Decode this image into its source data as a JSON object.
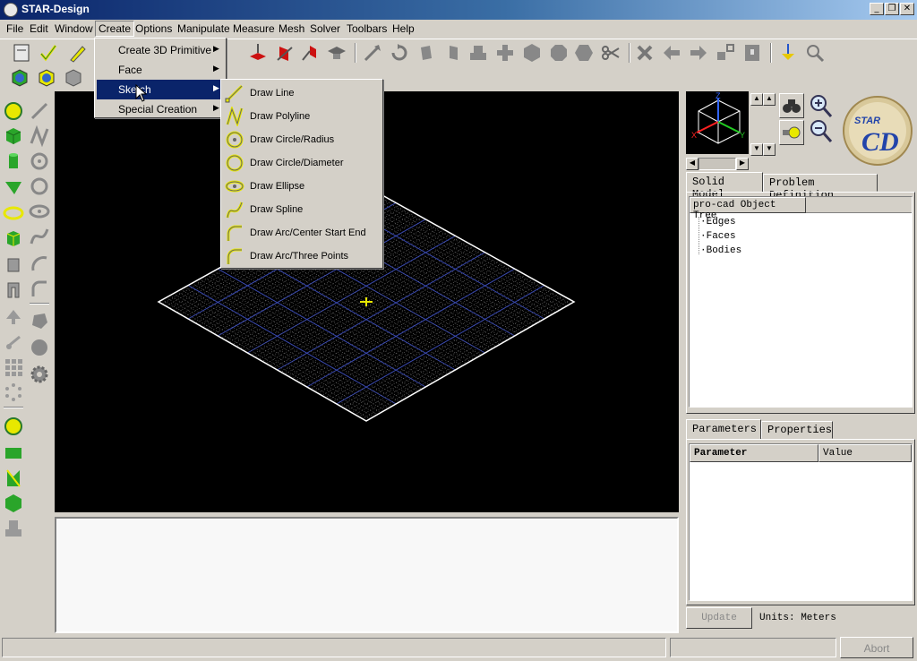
{
  "window": {
    "title": "STAR-Design",
    "controls": [
      "_",
      "❐",
      "✕"
    ]
  },
  "menubar": [
    "File",
    "Edit",
    "Window",
    "Create",
    "Options",
    "Manipulate",
    "Measure",
    "Mesh",
    "Solver",
    "Toolbars",
    "Help"
  ],
  "create_menu": {
    "items": [
      "Create 3D Primitive",
      "Face",
      "Sketch",
      "Special Creation"
    ],
    "highlighted": "Sketch"
  },
  "sketch_menu": {
    "items": [
      "Draw Line",
      "Draw Polyline",
      "Draw Circle/Radius",
      "Draw Circle/Diameter",
      "Draw Ellipse",
      "Draw Spline",
      "Draw Arc/Center Start End",
      "Draw Arc/Three Points"
    ]
  },
  "right_panel": {
    "tabs": [
      "Solid Model",
      "Problem Definition"
    ],
    "tree_header": "pro-cad Object Tree",
    "tree_items": [
      "Edges",
      "Faces",
      "Bodies"
    ],
    "lower_tabs": [
      "Parameters",
      "Properties"
    ],
    "table_headers": [
      "Parameter",
      "Value"
    ],
    "update_button": "Update",
    "units_label": "Units: Meters",
    "logo_text": "STAR CD"
  },
  "axes": {
    "z": "Z",
    "x": "X",
    "y": "Y"
  },
  "statusbar": {
    "abort_button": "Abort"
  },
  "colors": {
    "accent": "#0a246a",
    "icon_yellow": "#e8e800",
    "icon_green": "#2aa52a",
    "grid_gray": "#7a7a7a"
  }
}
